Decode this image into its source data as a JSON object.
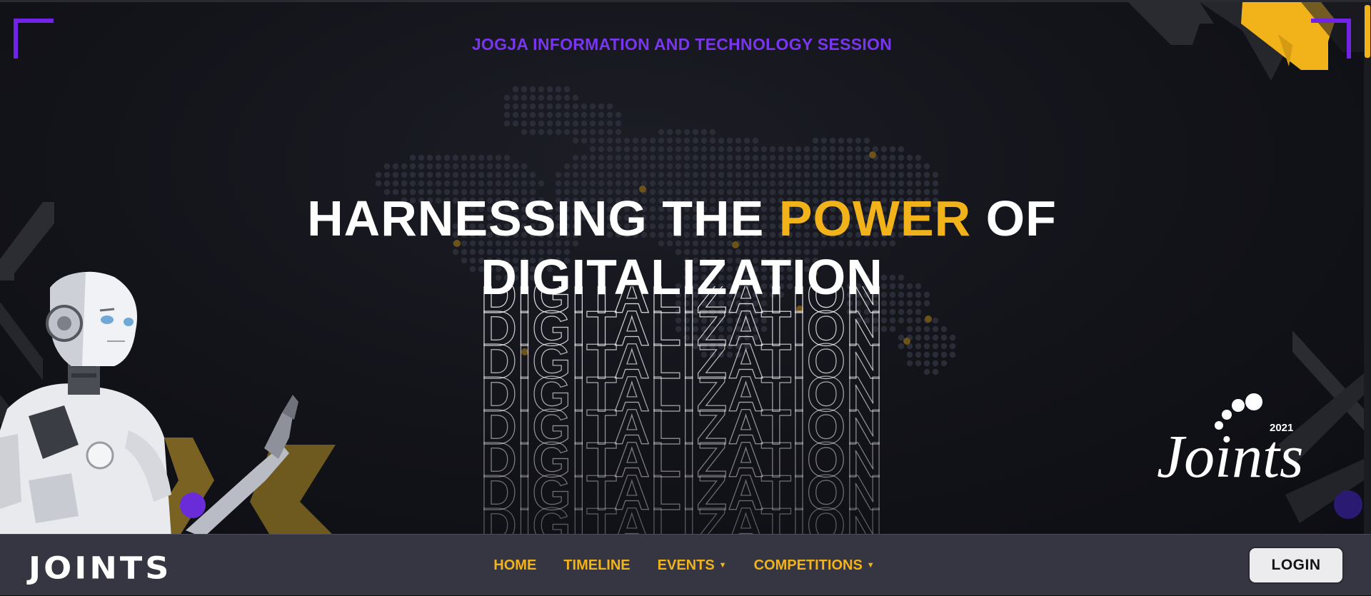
{
  "hero": {
    "subtitle": "JOGJA INFORMATION AND TECHNOLOGY SESSION",
    "headline_part1": "HARNESSING THE ",
    "headline_accent": "POWER",
    "headline_part2": " OF",
    "headline_line2": "DIGITALIZATION",
    "echo_text": "DIGITALIZATION",
    "logo_text": "Joints",
    "logo_year": "2021"
  },
  "navbar": {
    "brand": "JOINTS",
    "items": [
      {
        "label": "HOME",
        "has_dropdown": false
      },
      {
        "label": "TIMELINE",
        "has_dropdown": false
      },
      {
        "label": "EVENTS",
        "has_dropdown": true
      },
      {
        "label": "COMPETITIONS",
        "has_dropdown": true
      }
    ],
    "login_label": "LOGIN"
  },
  "colors": {
    "accent_yellow": "#f1b319",
    "accent_purple": "#7123e8",
    "background": "#121319",
    "navbar": "#363642"
  },
  "icons": [
    "robot-illustration",
    "world-map-dots",
    "chevron-decoration",
    "caret-down-icon"
  ]
}
